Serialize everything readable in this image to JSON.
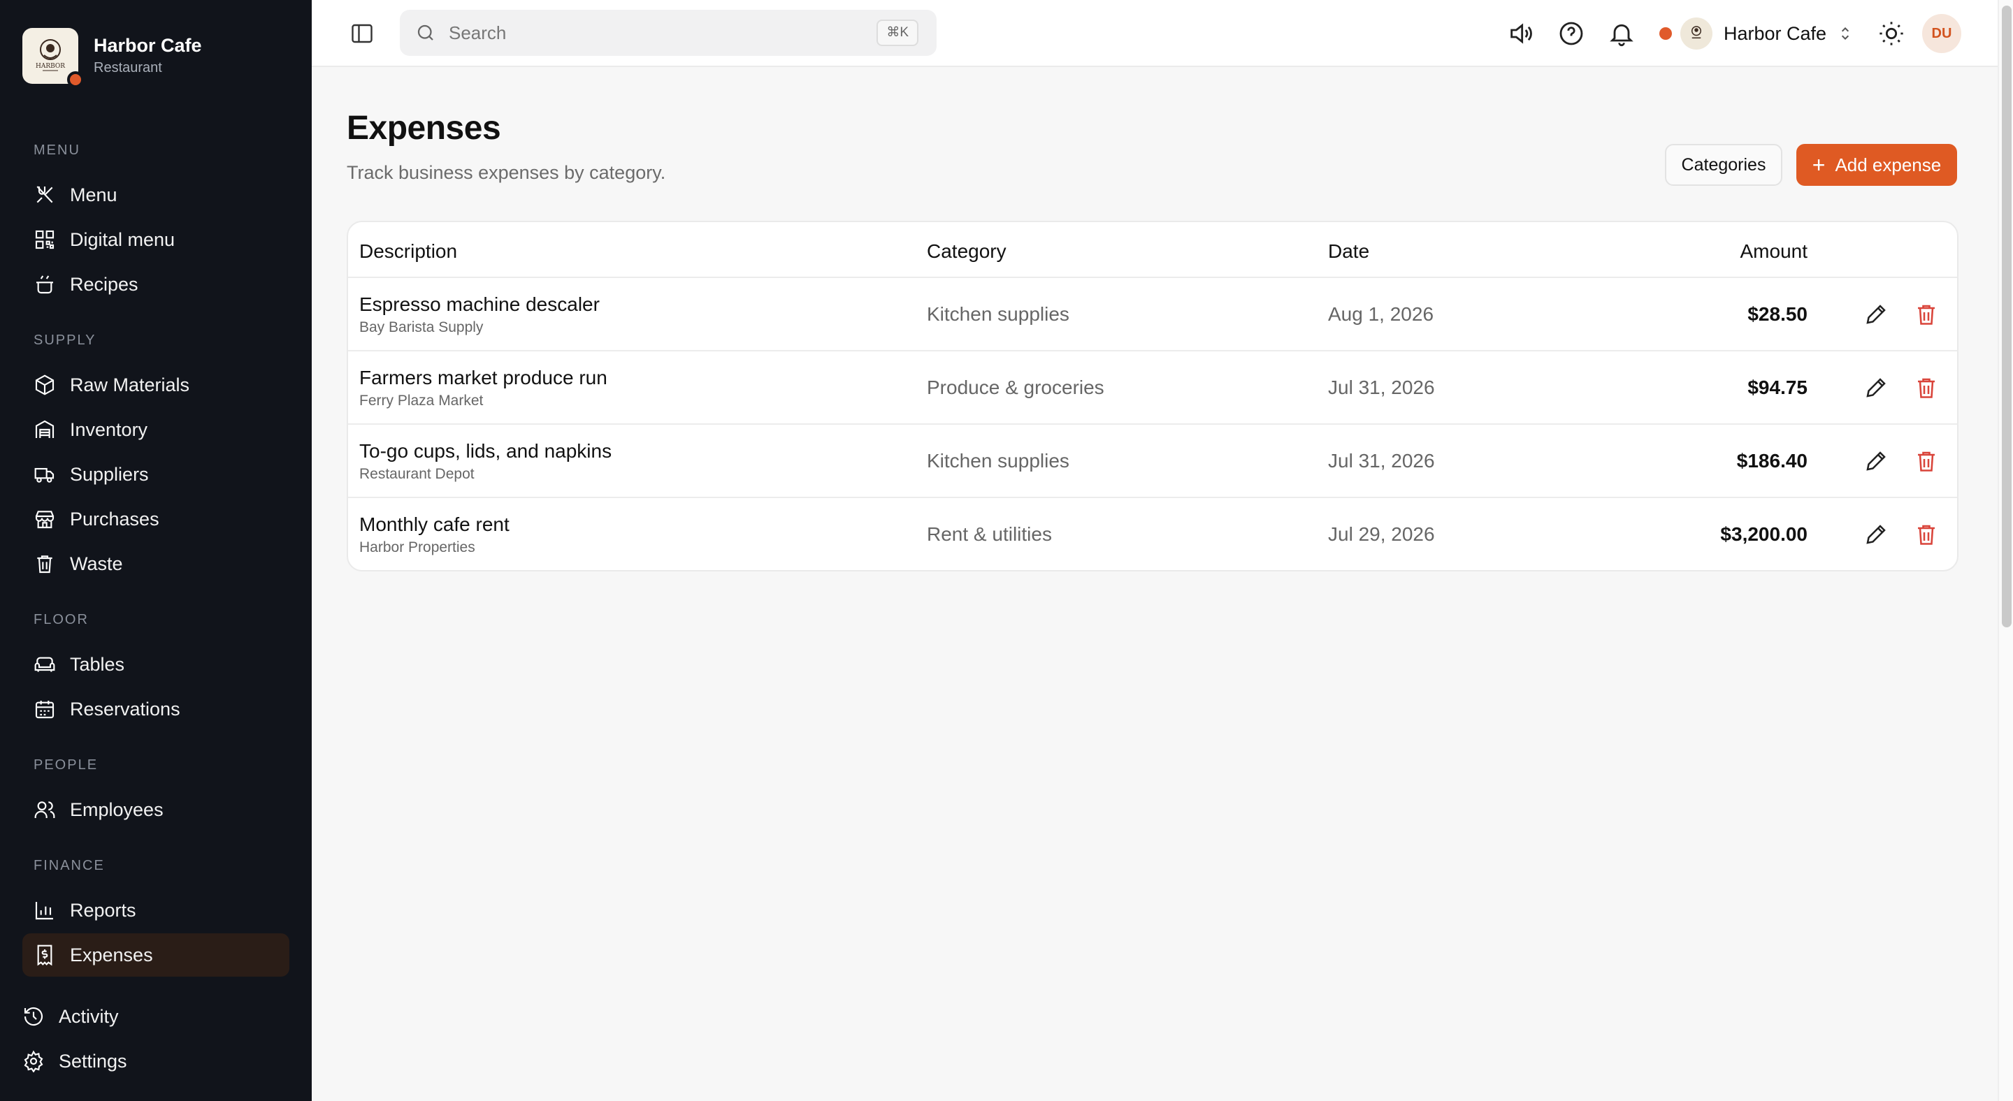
{
  "brand": {
    "name": "Harbor Cafe",
    "subtitle": "Restaurant",
    "logo_text": "HARBOR"
  },
  "sidebar": {
    "sections": {
      "menu": "MENU",
      "supply": "SUPPLY",
      "floor": "FLOOR",
      "people": "PEOPLE",
      "finance": "FINANCE"
    },
    "items": {
      "menu": "Menu",
      "digital_menu": "Digital menu",
      "recipes": "Recipes",
      "raw_materials": "Raw Materials",
      "inventory": "Inventory",
      "suppliers": "Suppliers",
      "purchases": "Purchases",
      "waste": "Waste",
      "tables": "Tables",
      "reservations": "Reservations",
      "employees": "Employees",
      "reports": "Reports",
      "expenses": "Expenses",
      "activity": "Activity",
      "settings": "Settings"
    },
    "active": "expenses"
  },
  "topbar": {
    "search_placeholder": "Search",
    "search_shortcut": "⌘K",
    "workspace_name": "Harbor Cafe",
    "avatar_initials": "DU",
    "icons": [
      "sidebar-toggle-icon",
      "search-icon",
      "speaker-icon",
      "help-icon",
      "bell-icon",
      "theme-sun-icon"
    ]
  },
  "page": {
    "title": "Expenses",
    "subtitle": "Track business expenses by category.",
    "categories_button": "Categories",
    "add_button": "Add expense"
  },
  "table": {
    "headers": {
      "description": "Description",
      "category": "Category",
      "date": "Date",
      "amount": "Amount"
    },
    "rows": [
      {
        "title": "Espresso machine descaler",
        "vendor": "Bay Barista Supply",
        "category": "Kitchen supplies",
        "date": "Aug 1, 2026",
        "amount": "$28.50"
      },
      {
        "title": "Farmers market produce run",
        "vendor": "Ferry Plaza Market",
        "category": "Produce & groceries",
        "date": "Jul 31, 2026",
        "amount": "$94.75"
      },
      {
        "title": "To-go cups, lids, and napkins",
        "vendor": "Restaurant Depot",
        "category": "Kitchen supplies",
        "date": "Jul 31, 2026",
        "amount": "$186.40"
      },
      {
        "title": "Monthly cafe rent",
        "vendor": "Harbor Properties",
        "category": "Rent & utilities",
        "date": "Jul 29, 2026",
        "amount": "$3,200.00"
      }
    ]
  },
  "colors": {
    "accent": "#df5a23",
    "sidebar_bg": "#11141b",
    "delete": "#d9443a"
  }
}
